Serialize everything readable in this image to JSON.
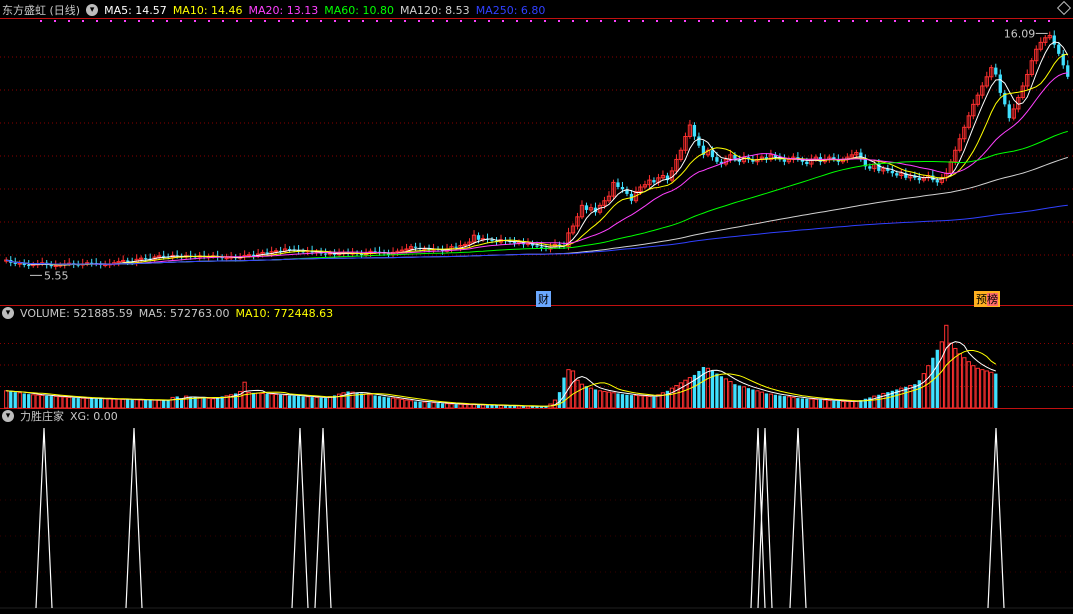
{
  "stock_header": {
    "title": "东方盛虹 (日线)",
    "ma_items": [
      {
        "label": "MA5: 14.57",
        "color": "#ffffff"
      },
      {
        "label": "MA10: 14.46",
        "color": "#ffff00"
      },
      {
        "label": "MA20: 13.13",
        "color": "#ff40ff"
      },
      {
        "label": "MA60: 10.80",
        "color": "#00ff00"
      },
      {
        "label": "MA120: 8.53",
        "color": "#d0d0d0"
      },
      {
        "label": "MA250: 6.80",
        "color": "#3040ff"
      }
    ]
  },
  "volume_header": {
    "items": [
      {
        "label": "VOLUME: 521885.59",
        "color": "#c8c8c8"
      },
      {
        "label": "MA5: 572763.00",
        "color": "#c8c8c8"
      },
      {
        "label": "MA10: 772448.63",
        "color": "#ffff00"
      }
    ]
  },
  "indicator_header": {
    "items": [
      {
        "label": "力胜庄家",
        "color": "#c8c8c8"
      },
      {
        "label": "XG: 0.00",
        "color": "#c8c8c8"
      }
    ]
  },
  "price_labels": {
    "high": "16.09",
    "low": "5.55"
  },
  "markers": {
    "cai": "财",
    "yu": "预",
    "bang": "榜"
  },
  "colors": {
    "up": "#ff3030",
    "down": "#40e0ff",
    "grid": "#8a0000",
    "separator": "#c01010"
  },
  "chart_data": [
    {
      "type": "candlestick",
      "title": "东方盛虹 (日线)",
      "ylim": [
        5.0,
        16.5
      ],
      "annotations": [
        "16.09",
        "5.55"
      ],
      "close": [
        6.22,
        6.1,
        6.05,
        6.08,
        6.0,
        5.98,
        6.02,
        6.05,
        6.1,
        6.0,
        5.95,
        5.98,
        6.0,
        6.05,
        6.08,
        6.02,
        6.0,
        6.05,
        6.1,
        6.08,
        6.05,
        6.0,
        6.02,
        6.05,
        6.1,
        6.15,
        6.2,
        6.15,
        6.1,
        6.25,
        6.3,
        6.28,
        6.25,
        6.35,
        6.4,
        6.38,
        6.35,
        6.42,
        6.38,
        6.35,
        6.4,
        6.38,
        6.35,
        6.4,
        6.35,
        6.38,
        6.4,
        6.35,
        6.3,
        6.32,
        6.35,
        6.3,
        6.35,
        6.42,
        6.45,
        6.4,
        6.48,
        6.55,
        6.5,
        6.58,
        6.62,
        6.6,
        6.7,
        6.68,
        6.65,
        6.6,
        6.58,
        6.62,
        6.55,
        6.58,
        6.5,
        6.48,
        6.52,
        6.45,
        6.5,
        6.55,
        6.5,
        6.52,
        6.48,
        6.45,
        6.5,
        6.6,
        6.58,
        6.55,
        6.5,
        6.45,
        6.55,
        6.6,
        6.65,
        6.7,
        6.8,
        6.75,
        6.7,
        6.72,
        6.65,
        6.7,
        6.68,
        6.6,
        6.7,
        6.8,
        6.75,
        6.85,
        6.9,
        7.0,
        7.3,
        7.1,
        7.15,
        7.1,
        7.05,
        7.0,
        7.1,
        7.05,
        7.0,
        6.95,
        7.0,
        6.9,
        6.95,
        6.85,
        6.8,
        6.75,
        6.7,
        6.8,
        6.9,
        6.85,
        6.8,
        7.4,
        7.7,
        8.1,
        8.6,
        8.4,
        8.5,
        8.3,
        8.6,
        8.8,
        9.0,
        9.6,
        9.4,
        9.3,
        9.1,
        8.8,
        9.2,
        9.4,
        9.5,
        9.7,
        9.6,
        9.8,
        9.9,
        9.7,
        10.1,
        10.6,
        11.0,
        11.6,
        12.1,
        11.6,
        11.2,
        10.8,
        11.0,
        10.7,
        10.5,
        10.4,
        10.6,
        10.8,
        10.6,
        10.5,
        10.7,
        10.6,
        10.5,
        10.6,
        10.7,
        10.6,
        10.8,
        10.7,
        10.6,
        10.5,
        10.6,
        10.7,
        10.6,
        10.5,
        10.4,
        10.6,
        10.7,
        10.5,
        10.6,
        10.7,
        10.6,
        10.5,
        10.6,
        10.7,
        10.8,
        10.9,
        10.6,
        10.3,
        10.2,
        10.4,
        10.1,
        10.2,
        10.1,
        10.0,
        9.9,
        10.0,
        9.8,
        9.9,
        9.8,
        9.7,
        9.8,
        9.9,
        9.7,
        9.6,
        9.8,
        10.0,
        10.5,
        11.0,
        11.5,
        12.0,
        12.5,
        13.0,
        13.4,
        13.8,
        14.2,
        14.6,
        14.3,
        13.5,
        13.0,
        12.4,
        12.8,
        13.3,
        13.8,
        14.3,
        14.9,
        15.4,
        15.7,
        15.9,
        16.0,
        15.6,
        15.2,
        14.7,
        14.2
      ]
    },
    {
      "type": "bar",
      "title": "VOLUME",
      "ylim": [
        0,
        1300000
      ],
      "values": [
        260000,
        250000,
        240000,
        230000,
        220000,
        210000,
        200000,
        195000,
        190000,
        185000,
        180000,
        175000,
        170000,
        165000,
        160000,
        155000,
        150000,
        148000,
        146000,
        144000,
        142000,
        140000,
        138000,
        136000,
        134000,
        132000,
        130000,
        128000,
        126000,
        124000,
        122000,
        120000,
        119000,
        118000,
        117000,
        116000,
        115000,
        160000,
        175000,
        145000,
        180000,
        170000,
        165000,
        155000,
        150000,
        145000,
        140000,
        160000,
        175000,
        185000,
        200000,
        220000,
        250000,
        390000,
        235000,
        230000,
        225000,
        220000,
        215000,
        210000,
        205000,
        200000,
        195000,
        190000,
        185000,
        180000,
        175000,
        170000,
        165000,
        160000,
        155000,
        150000,
        170000,
        190000,
        210000,
        230000,
        250000,
        240000,
        230000,
        220000,
        210000,
        200000,
        190000,
        180000,
        170000,
        160000,
        150000,
        140000,
        130000,
        120000,
        110000,
        100000,
        95000,
        90000,
        85000,
        80000,
        75000,
        70000,
        65000,
        60000,
        58000,
        56000,
        54000,
        52000,
        50000,
        48000,
        46000,
        44000,
        42000,
        40000,
        38000,
        36000,
        34000,
        32000,
        30000,
        28000,
        26000,
        24000,
        22000,
        20000,
        30000,
        60000,
        120000,
        240000,
        460000,
        580000,
        560000,
        420000,
        360000,
        330000,
        300000,
        280000,
        260000,
        250000,
        240000,
        230000,
        220000,
        210000,
        200000,
        195000,
        190000,
        185000,
        180000,
        175000,
        170000,
        200000,
        230000,
        260000,
        300000,
        340000,
        380000,
        420000,
        460000,
        500000,
        560000,
        620000,
        600000,
        560000,
        520000,
        480000,
        440000,
        400000,
        360000,
        340000,
        320000,
        300000,
        280000,
        260000,
        240000,
        220000,
        210000,
        200000,
        190000,
        180000,
        170000,
        160000,
        150000,
        145000,
        140000,
        135000,
        130000,
        125000,
        120000,
        115000,
        110000,
        105000,
        100000,
        100000,
        100000,
        100000,
        120000,
        140000,
        160000,
        180000,
        200000,
        220000,
        240000,
        260000,
        280000,
        300000,
        320000,
        340000,
        360000,
        420000,
        520000,
        640000,
        760000,
        880000,
        1000000,
        1250000,
        980000,
        900000,
        820000,
        760000,
        700000,
        640000,
        600000,
        580000,
        560000,
        540000,
        520000
      ]
    },
    {
      "type": "line",
      "title": "力胜庄家",
      "ylim": [
        0,
        1
      ],
      "x": [
        8,
        9,
        10,
        11,
        12,
        13,
        14,
        15,
        16,
        17,
        18,
        19,
        20,
        21,
        22,
        23,
        24,
        25,
        26,
        27,
        28,
        29,
        30,
        31,
        32,
        33,
        34,
        35,
        36,
        37,
        38,
        39,
        40,
        41,
        42,
        43,
        44,
        45,
        46,
        47,
        48,
        49,
        50
      ],
      "values": [
        1,
        0,
        0,
        0,
        0,
        0,
        0,
        0,
        0,
        0,
        1,
        0,
        0,
        0,
        0,
        0,
        0,
        0,
        0,
        0,
        0,
        0,
        0,
        0,
        0,
        0,
        0,
        0,
        0,
        0,
        0,
        0,
        0,
        0,
        0,
        0,
        0,
        0,
        0,
        0,
        0,
        0,
        0
      ]
    }
  ]
}
